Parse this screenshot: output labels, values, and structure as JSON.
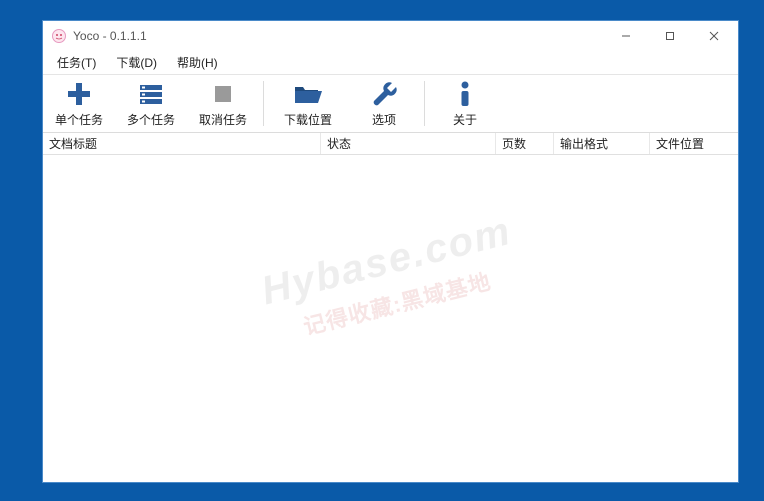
{
  "titlebar": {
    "title": "Yoco - 0.1.1.1"
  },
  "menu": {
    "tasks": "任务(T)",
    "downloads": "下载(D)",
    "help": "帮助(H)"
  },
  "toolbar": {
    "single_task": "单个任务",
    "multi_task": "多个任务",
    "cancel_task": "取消任务",
    "download_location": "下载位置",
    "options": "选项",
    "about": "关于"
  },
  "columns": {
    "doc_title": "文档标题",
    "status": "状态",
    "pages": "页数",
    "output_format": "输出格式",
    "file_location": "文件位置"
  },
  "watermark": {
    "line1": "Hybase.com",
    "line2": "记得收藏:黑域基地"
  },
  "colors": {
    "icon": "#2d5f9e"
  }
}
